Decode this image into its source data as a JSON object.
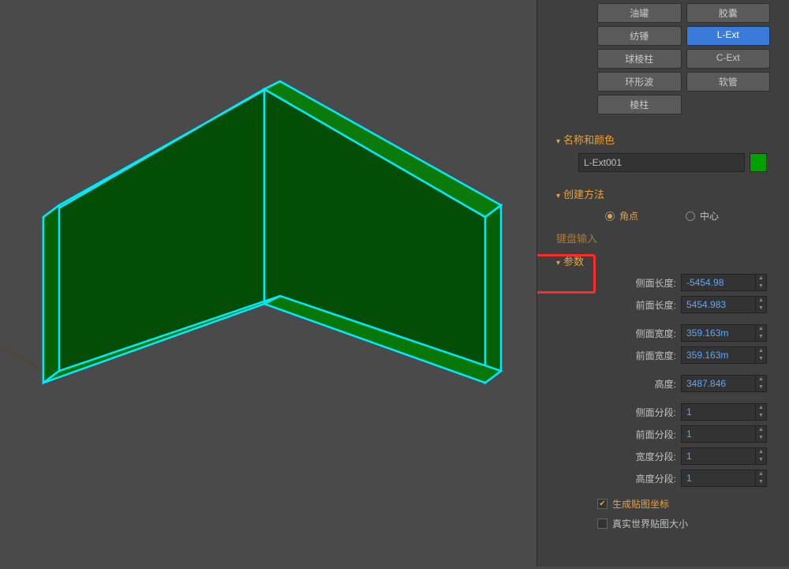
{
  "object_types": {
    "row0": [
      "油罐",
      "胶囊"
    ],
    "row1": [
      "纺锤",
      "L-Ext"
    ],
    "row2": [
      "球棱柱",
      "C-Ext"
    ],
    "row3": [
      "环形波",
      "软管"
    ],
    "row4": [
      "棱柱",
      ""
    ]
  },
  "selected_type": "L-Ext",
  "sections": {
    "name_color": "名称和颜色",
    "create_method": "创建方法",
    "keyboard_input": "键盘输入",
    "parameters": "参数"
  },
  "object_name": "L-Ext001",
  "object_color": "#00a000",
  "create_method": {
    "corner": "角点",
    "center": "中心",
    "selected": "角点"
  },
  "params": {
    "side_length": {
      "label": "侧面长度:",
      "value": "-5454.98"
    },
    "front_length": {
      "label": "前面长度:",
      "value": "5454.983"
    },
    "side_width": {
      "label": "侧面宽度:",
      "value": "359.163m"
    },
    "front_width": {
      "label": "前面宽度:",
      "value": "359.163m"
    },
    "height": {
      "label": "高度:",
      "value": "3487.846"
    },
    "side_segs": {
      "label": "侧面分段:",
      "value": "1"
    },
    "front_segs": {
      "label": "前面分段:",
      "value": "1"
    },
    "width_segs": {
      "label": "宽度分段:",
      "value": "1"
    },
    "height_segs": {
      "label": "高度分段:",
      "value": "1"
    }
  },
  "checkboxes": {
    "gen_mapping": {
      "label": "生成贴图坐标",
      "checked": true
    },
    "real_world": {
      "label": "真实世界贴图大小",
      "checked": false
    }
  }
}
